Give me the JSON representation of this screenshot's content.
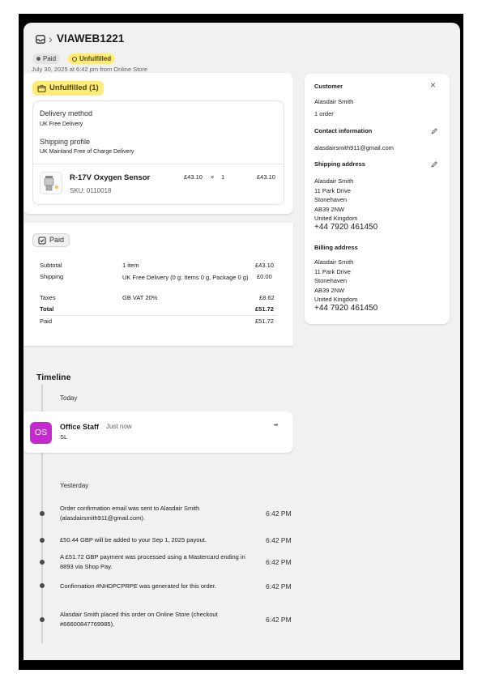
{
  "header": {
    "separator": "›",
    "order_id": "VIAWEB1221",
    "badges": {
      "paid": "Paid",
      "unfulfilled": "Unfulfilled"
    },
    "date_line": "July 30, 2025 at 6:42 pm from Online Store"
  },
  "fulfillment": {
    "status_label": "Unfulfilled (1)",
    "delivery_method_label": "Delivery method",
    "delivery_method_value": "UK Free Delivery",
    "shipping_profile_label": "Shipping profile",
    "shipping_profile_value": "UK Mainland Free of Charge Delivery",
    "item": {
      "name": "R-17V Oxygen Sensor",
      "sku": "SKU: 0110018",
      "unit_price": "£43.10",
      "times": "×",
      "quantity": "1",
      "line_total": "£43.10"
    }
  },
  "payment": {
    "status_label": "Paid",
    "rows": [
      {
        "label": "Subtotal",
        "detail": "1 item",
        "amount": "£43.10"
      },
      {
        "label": "Shipping",
        "detail": "UK Free Delivery (0 g: Items 0 g, Package 0 g)",
        "amount": "£0.00"
      },
      {
        "label": "Taxes",
        "detail": "GB VAT 20%",
        "amount": "£8.62"
      },
      {
        "label": "Total",
        "detail": "",
        "amount": "£51.72"
      },
      {
        "label": "Paid",
        "detail": "",
        "amount": "£51.72"
      }
    ]
  },
  "customer": {
    "heading": "Customer",
    "close": "×",
    "name": "Alasdair Smith",
    "orders": "1 order",
    "contact_heading": "Contact information",
    "email": "alasdairsmith911@gmail.com",
    "shipping_heading": "Shipping address",
    "shipping_lines": [
      "Alasdair Smith",
      "11 Park Drive",
      "Stonehaven",
      "AB39 2NW",
      "United Kingdom"
    ],
    "shipping_phone": "+44 7920 461450",
    "billing_heading": "Billing address",
    "billing_lines": [
      "Alasdair Smith",
      "11 Park Drive",
      "Stonehaven",
      "AB39 2NW",
      "United Kingdom"
    ],
    "billing_phone": "+44 7920 461450"
  },
  "timeline": {
    "title": "Timeline",
    "today_label": "Today",
    "staff": {
      "initials": "OS",
      "name": "Office Staff",
      "time": "Just now",
      "comment": "SL",
      "menu": "•••"
    },
    "yesterday_label": "Yesterday",
    "events": [
      {
        "text": "Order confirmation email was sent to Alasdair Smith (alasdairsmith911@gmail.com).",
        "time": "6:42 PM"
      },
      {
        "text": "£50.44 GBP will be added to your Sep 1, 2025 payout.",
        "time": "6:42 PM"
      },
      {
        "text": "A £51.72 GBP payment was processed using a Mastercard ending in 8893 via Shop Pay.",
        "time": "6:42 PM"
      },
      {
        "text": "Confirmation #NHDPCPRPE was generated for this order.",
        "time": "6:42 PM"
      },
      {
        "text": "Alasdair Smith placed this order on Online Store (checkout #66600847769985).",
        "time": "6:42 PM"
      }
    ]
  },
  "colors": {
    "unfulfilled_badge": "#ffeb78",
    "avatar": "#c52ad0",
    "page_bg": "#f1f1f1"
  }
}
